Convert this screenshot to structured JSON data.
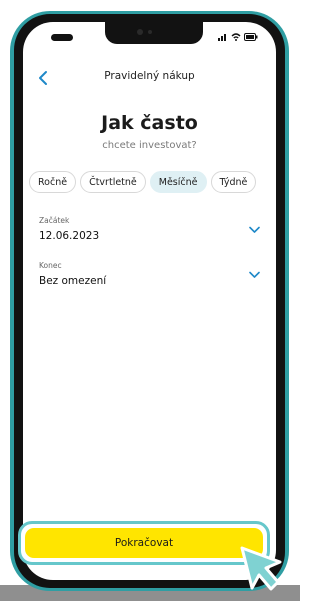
{
  "status_bar": {
    "icons": [
      "signal-icon",
      "wifi-icon",
      "battery-icon"
    ]
  },
  "header": {
    "title": "Pravidelný nákup",
    "back_icon": "chevron-left-icon"
  },
  "heading": {
    "title": "Jak často",
    "subtitle": "chcete investovat?"
  },
  "frequency": {
    "options": [
      "Ročně",
      "Čtvrtletně",
      "Měsíčně",
      "Týdně"
    ],
    "selected": "Měsíčně"
  },
  "start_field": {
    "label": "Začátek",
    "value": "12.06.2023"
  },
  "end_field": {
    "label": "Konec",
    "value": "Bez omezení"
  },
  "cta": {
    "label": "Pokračovat"
  },
  "colors": {
    "accent": "#ffe500",
    "highlight": "#66c7cb",
    "link": "#1e88c8",
    "selected_chip": "#dff0f4",
    "frame": "#2f9ea3"
  }
}
